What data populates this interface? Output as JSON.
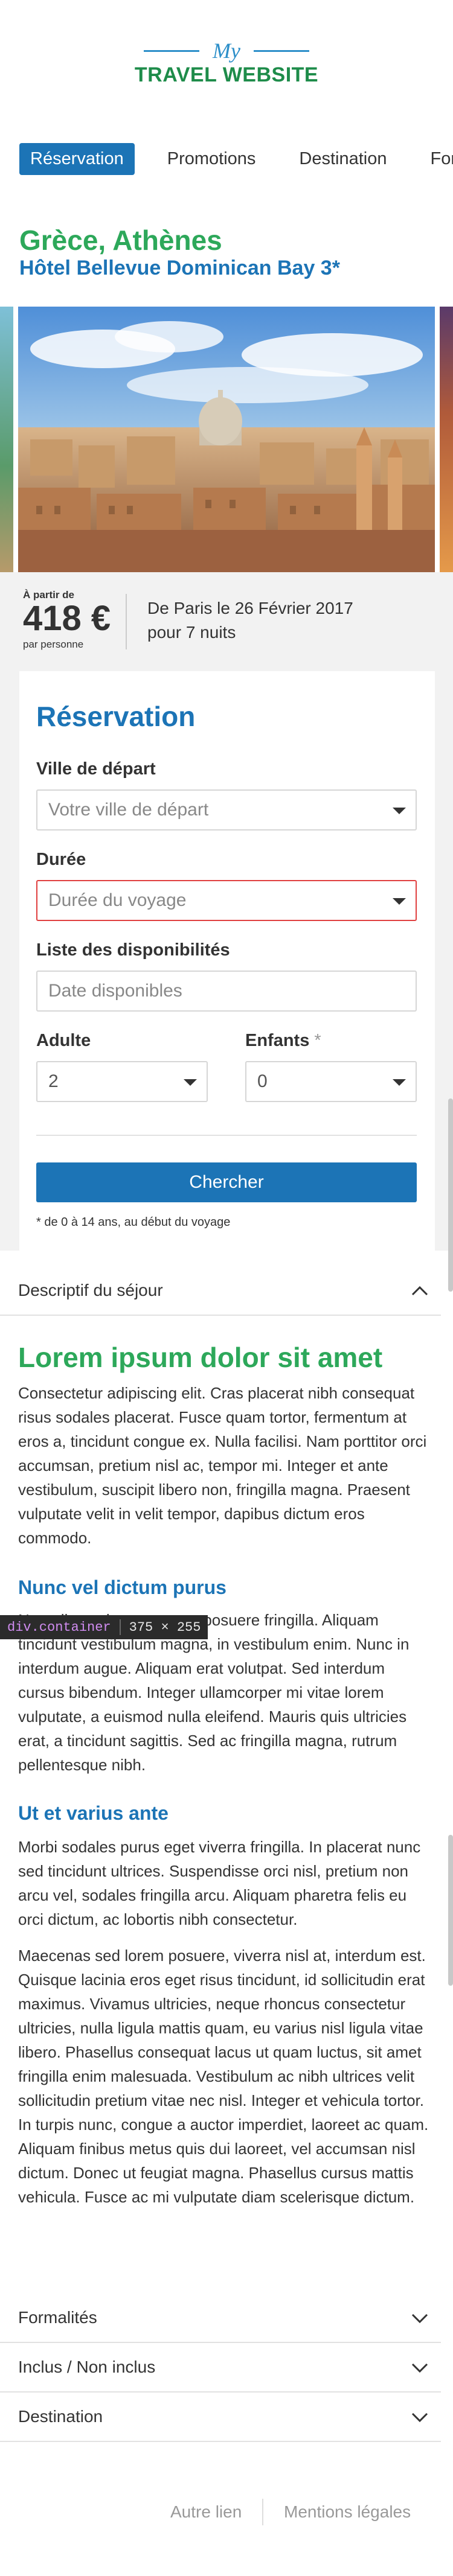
{
  "logo": {
    "small": "My",
    "main": "TRAVEL WEBSITE"
  },
  "nav": {
    "items": [
      {
        "label": "Réservation",
        "active": true
      },
      {
        "label": "Promotions"
      },
      {
        "label": "Destination"
      },
      {
        "label": "Formu"
      }
    ]
  },
  "destination": {
    "title": "Grèce, Athènes",
    "hotel": "Hôtel Bellevue Dominican Bay 3*"
  },
  "price": {
    "from": "À partir de",
    "value": "418 €",
    "per": "par personne",
    "desc_line1": "De Paris le 26 Février 2017",
    "desc_line2": "pour 7 nuits"
  },
  "reservation": {
    "title": "Réservation",
    "departure_label": "Ville de départ",
    "departure_placeholder": "Votre ville de départ",
    "duration_label": "Durée",
    "duration_placeholder": "Durée du voyage",
    "availability_label": "Liste des disponibilités",
    "availability_placeholder": "Date disponibles",
    "adult_label": "Adulte",
    "adult_value": "2",
    "children_label": "Enfants",
    "children_star": "*",
    "children_value": "0",
    "search_button": "Chercher",
    "note": "* de 0 à 14 ans, au début du voyage"
  },
  "accordion": {
    "description": "Descriptif du séjour",
    "formalities": "Formalités",
    "included": "Inclus / Non inclus",
    "destination": "Destination"
  },
  "content": {
    "h1": "Lorem ipsum dolor sit amet",
    "p1": "Consectetur adipiscing elit. Cras placerat nibh consequat risus sodales placerat. Fusce quam tortor, fermentum at eros a, tincidunt congue ex. Nulla facilisi. Nam porttitor orci accumsan, pretium nisl ac, tempor mi. Integer et ante vestibulum, suscipit libero non, fringilla magna. Praesent vulputate velit in velit tempor, dapibus dictum eros commodo.",
    "h2a": "Nunc vel dictum purus",
    "p2": "Nam dictum luctus sem et posuere fringilla. Aliquam tincidunt vestibulum magna, in vestibulum enim. Nunc in interdum augue. Aliquam erat volutpat. Sed interdum cursus bibendum. Integer ullamcorper mi vitae lorem vulputate, a euismod nulla eleifend. Mauris quis ultricies erat, a tincidunt sagittis. Sed ac fringilla magna, rutrum pellentesque nibh.",
    "h2b": "Ut et varius ante",
    "p3": "Morbi sodales purus eget viverra fringilla. In placerat nunc sed tincidunt ultrices. Suspendisse orci nisl, pretium non arcu vel, sodales fringilla arcu. Aliquam pharetra felis eu orci dictum, ac lobortis nibh consectetur.",
    "p4": "Maecenas sed lorem posuere, viverra nisl at, interdum est. Quisque lacinia eros eget risus tincidunt, id sollicitudin erat maximus. Vivamus ultricies, neque rhoncus consectetur ultricies, nulla ligula mattis quam, eu varius nisl ligula vitae libero. Phasellus consequat lacus ut quam luctus, sit amet fringilla enim malesuada. Vestibulum ac nibh ultrices velit sollicitudin pretium vitae nec nisl. Integer et vehicula tortor. In turpis nunc, congue a auctor imperdiet, laoreet ac quam. Aliquam finibus metus quis dui laoreet, vel accumsan nisl dictum. Donec ut feugiat magna. Phasellus cursus mattis vehicula. Fusce ac mi vulputate diam scelerisque dictum."
  },
  "devtools": {
    "element": "div.container",
    "size": "375 × 255"
  },
  "footer": {
    "link1": "Autre lien",
    "link2": "Mentions légales"
  },
  "colors": {
    "brand_blue": "#1c74b6",
    "brand_green": "#2da85a",
    "error_red": "#e04040"
  }
}
